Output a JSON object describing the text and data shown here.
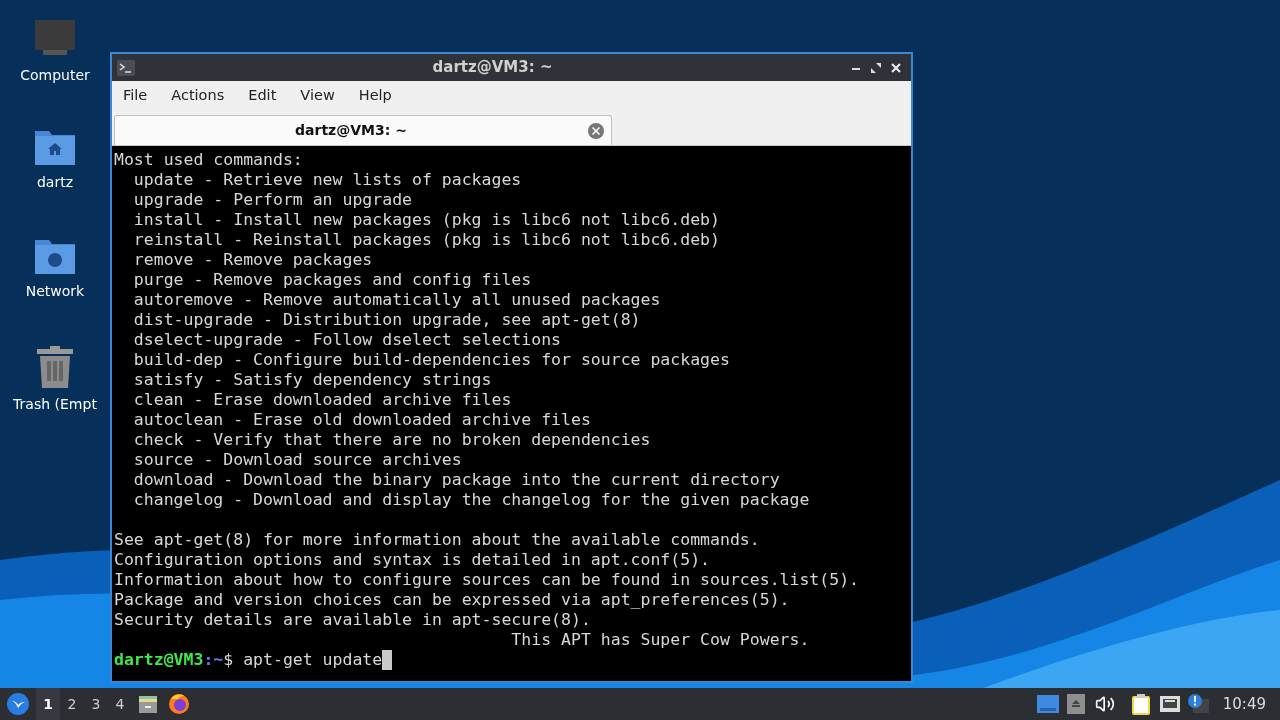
{
  "desktop_icons": [
    {
      "kind": "computer",
      "label": "Computer"
    },
    {
      "kind": "home",
      "label": "dartz"
    },
    {
      "kind": "network",
      "label": "Network"
    },
    {
      "kind": "trash",
      "label": "Trash (Empt"
    }
  ],
  "window": {
    "title": "dartz@VM3: ~",
    "menu": [
      "File",
      "Actions",
      "Edit",
      "View",
      "Help"
    ],
    "tabs": [
      {
        "label": "dartz@VM3: ~",
        "selected": true
      }
    ],
    "output_blocks": [
      [
        "Most used commands:",
        "  update - Retrieve new lists of packages",
        "  upgrade - Perform an upgrade",
        "  install - Install new packages (pkg is libc6 not libc6.deb)",
        "  reinstall - Reinstall packages (pkg is libc6 not libc6.deb)",
        "  remove - Remove packages",
        "  purge - Remove packages and config files",
        "  autoremove - Remove automatically all unused packages",
        "  dist-upgrade - Distribution upgrade, see apt-get(8)",
        "  dselect-upgrade - Follow dselect selections",
        "  build-dep - Configure build-dependencies for source packages",
        "  satisfy - Satisfy dependency strings",
        "  clean - Erase downloaded archive files",
        "  autoclean - Erase old downloaded archive files",
        "  check - Verify that there are no broken dependencies",
        "  source - Download source archives",
        "  download - Download the binary package into the current directory",
        "  changelog - Download and display the changelog for the given package"
      ],
      [
        "See apt-get(8) for more information about the available commands.",
        "Configuration options and syntax is detailed in apt.conf(5).",
        "Information about how to configure sources can be found in sources.list(5).",
        "Package and version choices can be expressed via apt_preferences(5).",
        "Security details are available in apt-secure(8).",
        "                                        This APT has Super Cow Powers."
      ]
    ],
    "prompt": {
      "user_host": "dartz@VM3",
      "path": ":~",
      "symbol": "$",
      "command": " apt-get update"
    }
  },
  "taskbar": {
    "workspaces": [
      {
        "label": "1",
        "selected": true
      },
      {
        "label": "2",
        "selected": false
      },
      {
        "label": "3",
        "selected": false
      },
      {
        "label": "4",
        "selected": false
      }
    ],
    "clock": "10:49"
  }
}
